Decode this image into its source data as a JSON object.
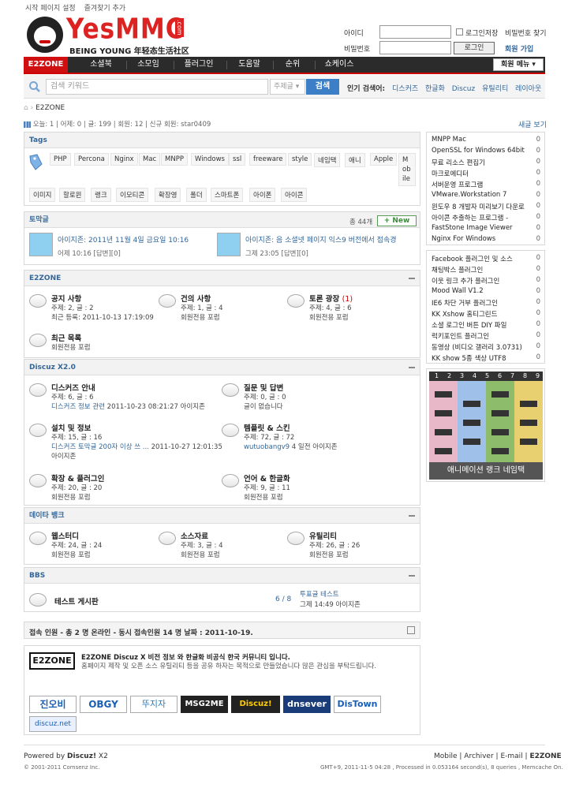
{
  "toplinks": [
    "시작 페이지 설정",
    "즐겨찾기 추가"
  ],
  "logo": {
    "brand": "YesMMC",
    "com": ".com",
    "tagline": "BEING YOUNG 年轻态生活社区"
  },
  "login": {
    "id_label": "아이디",
    "pw_label": "비밀번호",
    "remember": "로그인저장",
    "find_pw": "비밀번호 찾기",
    "login_btn": "로그인",
    "register": "회원 가입"
  },
  "nav": {
    "items": [
      "E2ZONE",
      "소셜북",
      "소모임",
      "플러그인",
      "도움말",
      "순위",
      "쇼케이스"
    ],
    "member_menu": "회원 메뉴"
  },
  "search": {
    "placeholder": "검색 키워드",
    "scope": "주제글",
    "button": "검색",
    "hot_label": "인기 검색어:",
    "hot": [
      "디스커즈",
      "한글화",
      "Discuz",
      "유틸리티",
      "레이아웃"
    ]
  },
  "breadcrumb": "E2ZONE",
  "stats": "오늘: 1 | 어제: 0 | 글: 199 | 회원: 12 | 신규 회원: star0409",
  "new_view": "새글 보기",
  "tags": {
    "title": "Tags",
    "row1": [
      "PHP",
      "Percona",
      "Nginx",
      "Mac",
      "MNPP",
      "Windows",
      "ssl",
      "freeware",
      "style",
      "네임택",
      "애니",
      "Apple",
      "Mobile"
    ],
    "row2": [
      "이미지",
      "할로윈",
      "랭크",
      "이모티콘",
      "확장영",
      "폴더",
      "스마트폰",
      "아이폰",
      "아이콘"
    ]
  },
  "topics": {
    "title": "토막글",
    "count": "총 44개",
    "new_btn": "+ New",
    "items": [
      {
        "title": "아이지존: 2011년 11월 4일 금요일 10:16",
        "meta": "어제 10:16 [답변][0]"
      },
      {
        "title": "아이지존: 음 소셜넷 페이지 익스9 버전에서 접속경",
        "meta": "그제 23:05 [답변][0]"
      }
    ]
  },
  "sections": [
    {
      "title": "E2ZONE",
      "forums": [
        {
          "name": "공지 사항",
          "count": "주제: 2, 글 : 2",
          "last": "최근 등록: 2011-10-13 17:19:09"
        },
        {
          "name": "건의 사항",
          "count": "주제: 1, 글 : 4",
          "last": "회원전용 포럼"
        },
        {
          "name": "토론 광장",
          "extra": "(1)",
          "count": "주제: 4, 글 : 6",
          "last": "회원전용 포럼"
        },
        {
          "name": "최근 목록",
          "count": "회원전용 포럼",
          "last": ""
        }
      ]
    },
    {
      "title": "Discuz X2.0",
      "forums": [
        {
          "name": "디스커즈 안내",
          "count": "주제: 6, 글 : 6",
          "link": "디스커즈 정보 관련",
          "last": "2011-10-23 08:21:27 아이지존"
        },
        {
          "name": "질문 및 답변",
          "count": "주제: 0, 글 : 0",
          "last": "글이 없습니다"
        },
        {
          "name": "설치 및 정보",
          "count": "주제: 15, 글 : 16",
          "link": "디스커즈 토막글 200자 이상 쓰 ...",
          "last": "2011-10-27 12:01:35",
          "last2": "아이지존"
        },
        {
          "name": "템플릿 & 스킨",
          "count": "주제: 72, 글 : 72",
          "link": "wutuobangv9",
          "last": "4 일전 아이지존"
        },
        {
          "name": "확장 & 플러그인",
          "count": "주제: 20, 글 : 20",
          "last": "회원전용 포럼"
        },
        {
          "name": "언어 & 한글화",
          "count": "주제: 9, 글 : 11",
          "last": "회원전용 포럼"
        }
      ]
    },
    {
      "title": "데이타 뱅크",
      "forums": [
        {
          "name": "웹스터디",
          "count": "주제: 24, 글 : 24",
          "last": "회원전용 포럼"
        },
        {
          "name": "소스자료",
          "count": "주제: 3, 글 : 4",
          "last": "회원전용 포럼"
        },
        {
          "name": "유틸리티",
          "count": "주제: 26, 글 : 26",
          "last": "회원전용 포럼"
        }
      ]
    },
    {
      "title": "BBS",
      "forums": [
        {
          "name": "테스트 게시판",
          "pages": "6 / 8",
          "link": "투표글 테스트",
          "last": "그제 14:49 아이지존"
        }
      ]
    }
  ],
  "online": "접속 인원 - 총 2 명 온라인 - 동시 접속인원 14 명 날짜 : 2011-10-19.",
  "about": {
    "logo": "E2ZONE",
    "text1": "E2ZONE Discuz X 비전 정보 와 한글화 비공식 한국 커뮤니티 입니다.",
    "text2": "홈페이지 제작 및 오픈 소스 유틸리티 등을 공유 하자는 목적으로 만들었습니다 많은 관심을 부탁드립니다.",
    "partners": [
      "진오비",
      "OBGY",
      "뚜지자",
      "MSG2ME",
      "Discuz!",
      "dnsever",
      "DisTown",
      "discuz.net"
    ]
  },
  "right_list1": [
    {
      "t": "MNPP Mac",
      "n": "0"
    },
    {
      "t": "OpenSSL for Windows 64bit",
      "n": "0"
    },
    {
      "t": "무료 리소스 편집기",
      "n": "0"
    },
    {
      "t": "마크로에디터",
      "n": "0"
    },
    {
      "t": "서버운영 프로그램",
      "n": "0"
    },
    {
      "t": "VMware.Workstation 7",
      "n": "0"
    },
    {
      "t": "윈도우 8 개발자 미리보기 다운로",
      "n": "0"
    },
    {
      "t": "아이콘 추출하는 프로그램 -",
      "n": "0"
    },
    {
      "t": "FastStone Image Viewer",
      "n": "0"
    },
    {
      "t": "Nginx For Windows",
      "n": "0"
    }
  ],
  "right_list2": [
    {
      "t": "Facebook 플러그인 및 소스",
      "n": "0"
    },
    {
      "t": "채팅박스 플러그인",
      "n": "0"
    },
    {
      "t": "이웃 링크 추가 플러그인",
      "n": "0"
    },
    {
      "t": "Mood Wall V1.2",
      "n": "0"
    },
    {
      "t": "IE6 차단 거부 플러그인",
      "n": "0"
    },
    {
      "t": "KK Xshow 홈티그린드",
      "n": "0"
    },
    {
      "t": "소셜 로그인 버튼 DIY 파일",
      "n": "0"
    },
    {
      "t": "럭키포인트 플러그인",
      "n": "0"
    },
    {
      "t": "동영상 (비디오 갤러리 3.0731)",
      "n": "0"
    },
    {
      "t": "KK show 5종 색상 UTF8",
      "n": "0"
    }
  ],
  "banner": {
    "caption": "애니메이션 랭크 네임택",
    "nums": [
      "1",
      "2",
      "3",
      "4",
      "5",
      "6",
      "7",
      "8",
      "9"
    ]
  },
  "footer": {
    "powered": "Powered by",
    "discuz": "Discuz!",
    "ver": "X2",
    "links": [
      "Mobile",
      "Archiver",
      "E-mail",
      "E2ZONE"
    ],
    "copy": "© 2001-2011 Comsenz Inc.",
    "proc": "GMT+9, 2011-11-5 04:28 , Processed in 0.053164 second(s), 8 queries , Memcache On."
  }
}
